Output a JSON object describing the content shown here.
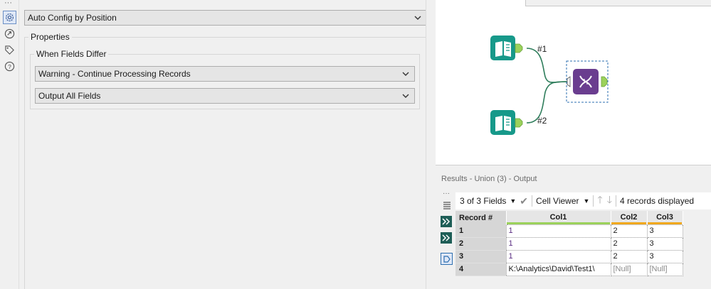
{
  "config": {
    "mode_select": "Auto Config by Position",
    "properties_label": "Properties",
    "when_fields_differ_label": "When Fields Differ",
    "action_select": "Warning - Continue Processing Records",
    "output_select": "Output All Fields"
  },
  "rail_icons": [
    "gear-icon",
    "connection-icon",
    "tag-icon",
    "help-icon"
  ],
  "workflow": {
    "input1_label": "#1",
    "input2_label": "#2",
    "colors": {
      "input_tool": "#17998a",
      "union_tool": "#6a3d8f",
      "anchor": "#9bd15b"
    }
  },
  "results": {
    "title": "Results - Union (3) - Output",
    "fields_select": "3 of 3 Fields",
    "cell_viewer": "Cell Viewer",
    "records_displayed": "4 records displayed",
    "columns": [
      "Record #",
      "Col1",
      "Col2",
      "Col3"
    ],
    "rows": [
      {
        "rec": "1",
        "col1": "1",
        "col2": "2",
        "col3": "3"
      },
      {
        "rec": "2",
        "col1": "1",
        "col2": "2",
        "col3": "3"
      },
      {
        "rec": "3",
        "col1": "1",
        "col2": "2",
        "col3": "3"
      },
      {
        "rec": "4",
        "col1": "K:\\Analytics\\David\\Test1\\",
        "col2": "[Null]",
        "col3": "[Null]"
      }
    ]
  }
}
